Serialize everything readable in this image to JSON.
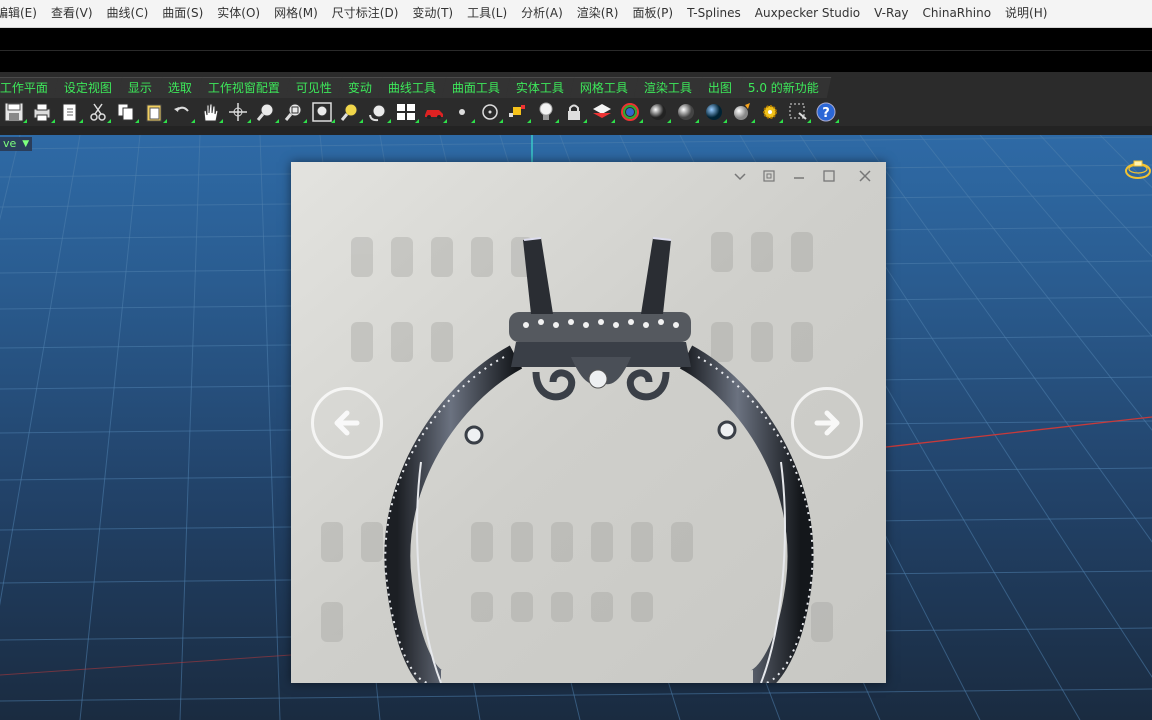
{
  "menu": {
    "items": [
      "编辑(E)",
      "查看(V)",
      "曲线(C)",
      "曲面(S)",
      "实体(O)",
      "网格(M)",
      "尺寸标注(D)",
      "变动(T)",
      "工具(L)",
      "分析(A)",
      "渲染(R)",
      "面板(P)",
      "T-Splines",
      "Auxpecker Studio",
      "V-Ray",
      "ChinaRhino",
      "说明(H)"
    ]
  },
  "tabs": [
    "工作平面",
    "设定视图",
    "显示",
    "选取",
    "工作视窗配置",
    "可见性",
    "变动",
    "曲线工具",
    "曲面工具",
    "实体工具",
    "网格工具",
    "渲染工具",
    "出图",
    "5.0 的新功能"
  ],
  "toolbar": {
    "icons": [
      "save-icon",
      "print-icon",
      "import-icon",
      "cut-icon",
      "copy-icon",
      "paste-icon",
      "undo-icon",
      "pan-hand-icon",
      "rotate-view-icon",
      "zoom-icon",
      "zoom-window-icon",
      "zoom-extents-icon",
      "zoom-selected-icon",
      "rotate-camera-icon",
      "four-viewports-icon",
      "car-icon",
      "point-icon",
      "circle-icon",
      "snap-icon",
      "light-bulb-icon",
      "lock-icon",
      "layer-icon",
      "color-wheel-icon",
      "render-sphere-icon",
      "material-sphere-icon",
      "blue-sphere-icon",
      "environment-icon",
      "settings-gear-icon",
      "selection-icon",
      "help-icon"
    ]
  },
  "viewport": {
    "label": "ve"
  },
  "viewer": {
    "controls": [
      "dropdown",
      "fit",
      "minimize",
      "maximize",
      "close"
    ]
  },
  "colors": {
    "tab_text": "#3de85a",
    "viewport_top": "#2e6aa6",
    "viewport_bottom": "#1a2b40"
  }
}
